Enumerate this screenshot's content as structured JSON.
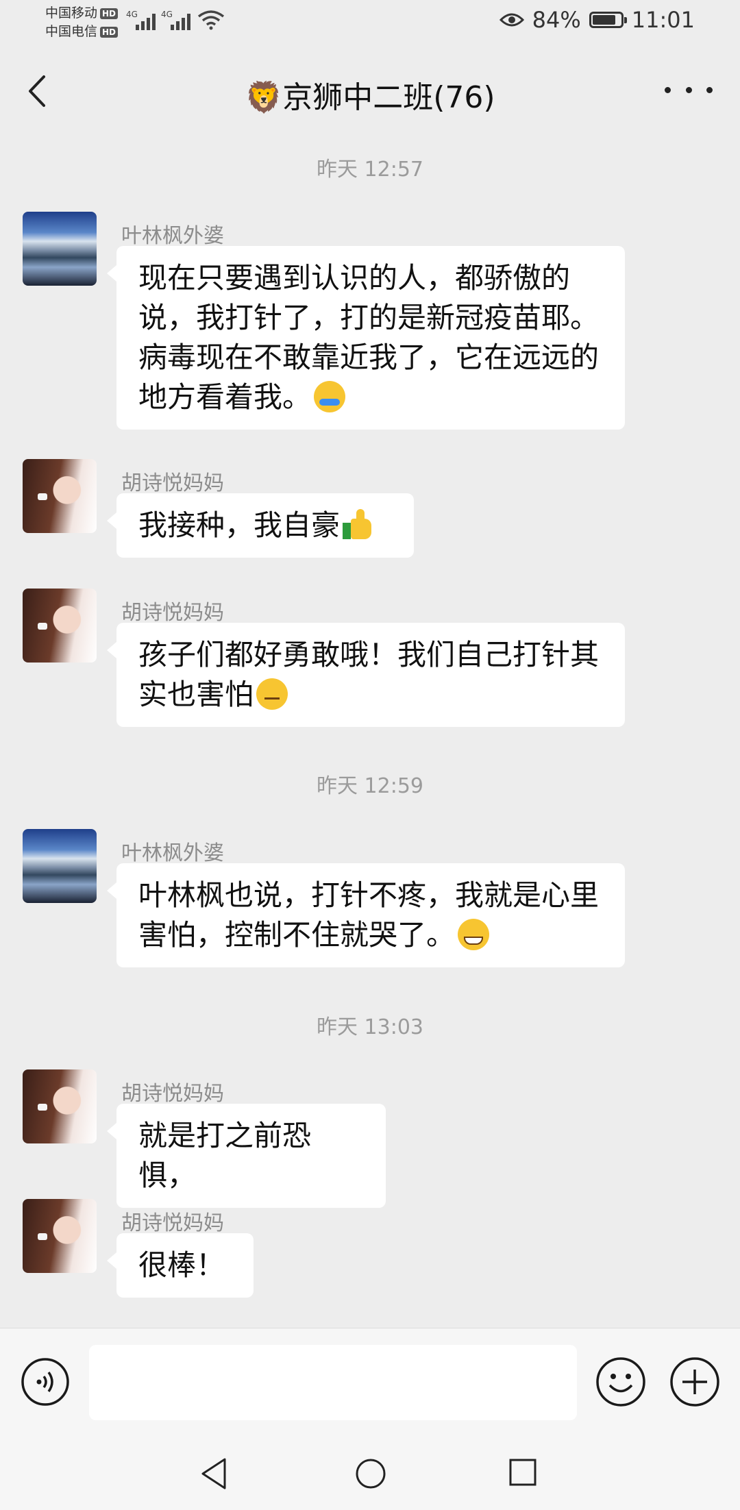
{
  "status_bar": {
    "carrier1": "中国移动",
    "carrier2": "中国电信",
    "hd": "HD",
    "network1": "4G",
    "network2": "4G",
    "battery_percent": "84%",
    "battery_level": 0.84,
    "time": "11:01"
  },
  "header": {
    "title": "🦁京狮中二班(76)"
  },
  "timestamps": [
    "昨天 12:57",
    "昨天 12:59",
    "昨天 13:03"
  ],
  "messages": [
    {
      "sender": "叶林枫外婆",
      "text": "现在只要遇到认识的人，都骄傲的说，我打针了，打的是新冠疫苗耶。病毒现在不敢靠近我了，它在远远的地方看着我。",
      "emoji": "crying-laughing-emoji"
    },
    {
      "sender": "胡诗悦妈妈",
      "text": "我接种，我自豪",
      "emoji": "thumbs-up-emoji"
    },
    {
      "sender": "胡诗悦妈妈",
      "text": "孩子们都好勇敢哦！我们自己打针其实也害怕",
      "emoji": "thinking-emoji"
    },
    {
      "sender": "叶林枫外婆",
      "text": "叶林枫也说，打针不疼，我就是心里害怕，控制不住就哭了。",
      "emoji": "grinning-emoji"
    },
    {
      "sender": "胡诗悦妈妈",
      "text": "就是打之前恐惧，"
    },
    {
      "sender": "胡诗悦妈妈",
      "text": "很棒！"
    }
  ],
  "input_bar": {
    "voice_icon": "voice-icon",
    "emoji_icon": "emoji-icon",
    "plus_icon": "plus-icon",
    "text_value": ""
  },
  "nav_bar": {
    "icons": [
      "back-triangle-icon",
      "home-circle-icon",
      "recent-square-icon"
    ]
  },
  "colors": {
    "background": "#ededed",
    "bubble": "#ffffff",
    "timestamp": "#9b9b9b",
    "sender": "#8c8c8c"
  }
}
